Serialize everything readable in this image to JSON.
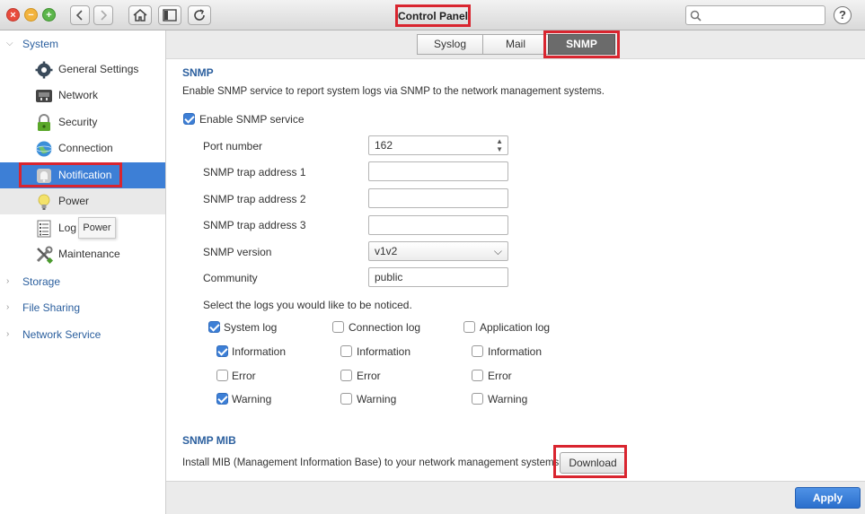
{
  "titlebar": {
    "title": "Control Panel",
    "search_placeholder": "",
    "help_label": "?"
  },
  "sidebar": {
    "sections": [
      {
        "label": "System",
        "expanded": true
      },
      {
        "label": "Storage",
        "expanded": false
      },
      {
        "label": "File Sharing",
        "expanded": false
      },
      {
        "label": "Network Service",
        "expanded": false
      }
    ],
    "items": [
      {
        "label": "General Settings",
        "icon": "gear-icon"
      },
      {
        "label": "Network",
        "icon": "network-icon"
      },
      {
        "label": "Security",
        "icon": "lock-icon"
      },
      {
        "label": "Connection",
        "icon": "globe-icon"
      },
      {
        "label": "Notification",
        "icon": "bell-icon",
        "active": true
      },
      {
        "label": "Power",
        "icon": "lightbulb-icon"
      },
      {
        "label": "Log",
        "icon": "log-icon"
      },
      {
        "label": "Maintenance",
        "icon": "tools-icon"
      }
    ],
    "tooltip": "Power"
  },
  "tabs": [
    {
      "label": "Syslog"
    },
    {
      "label": "Mail"
    },
    {
      "label": "SNMP",
      "active": true
    }
  ],
  "snmp": {
    "heading": "SNMP",
    "description": "Enable SNMP service to report system logs via SNMP to the network management systems.",
    "enable_label": "Enable SNMP service",
    "enable_checked": true,
    "fields": {
      "port": {
        "label": "Port number",
        "value": "162"
      },
      "trap1": {
        "label": "SNMP trap address 1",
        "value": ""
      },
      "trap2": {
        "label": "SNMP trap address 2",
        "value": ""
      },
      "trap3": {
        "label": "SNMP trap address 3",
        "value": ""
      },
      "version": {
        "label": "SNMP version",
        "value": "v1v2"
      },
      "community": {
        "label": "Community",
        "value": "public"
      }
    },
    "logs_prompt": "Select the logs you would like to be noticed.",
    "log_groups": [
      {
        "label": "System log",
        "checked": true,
        "options": [
          {
            "label": "Information",
            "checked": true
          },
          {
            "label": "Error",
            "checked": false
          },
          {
            "label": "Warning",
            "checked": true
          }
        ]
      },
      {
        "label": "Connection log",
        "checked": false,
        "options": [
          {
            "label": "Information",
            "checked": false
          },
          {
            "label": "Error",
            "checked": false
          },
          {
            "label": "Warning",
            "checked": false
          }
        ]
      },
      {
        "label": "Application log",
        "checked": false,
        "options": [
          {
            "label": "Information",
            "checked": false
          },
          {
            "label": "Error",
            "checked": false
          },
          {
            "label": "Warning",
            "checked": false
          }
        ]
      }
    ]
  },
  "mib": {
    "heading": "SNMP MIB",
    "description": "Install MIB (Management Information Base) to your network management systems.",
    "download_label": "Download"
  },
  "footer": {
    "apply_label": "Apply"
  },
  "colors": {
    "accent": "#3d7fd6",
    "highlight": "#d9252f",
    "heading": "#2b5f9e"
  }
}
